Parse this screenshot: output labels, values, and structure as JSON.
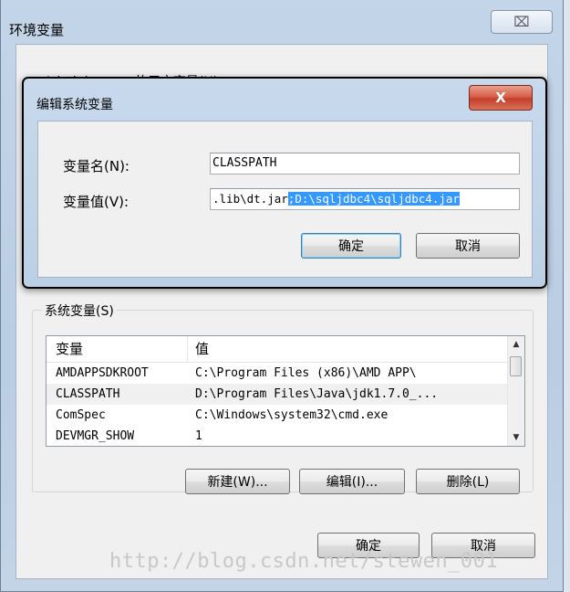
{
  "outer_dialog": {
    "title": "环境变量",
    "close_glyph": "⌧",
    "user_vars_label": "Administrator 的用户变量(U)",
    "system_vars_label": "系统变量(S)",
    "table": {
      "col_name": "变量",
      "col_value": "值",
      "rows": [
        {
          "name": "AMDAPPSDKROOT",
          "value": "C:\\Program Files (x86)\\AMD APP\\"
        },
        {
          "name": "CLASSPATH",
          "value": "D:\\Program Files\\Java\\jdk1.7.0_..."
        },
        {
          "name": "ComSpec",
          "value": "C:\\Windows\\system32\\cmd.exe"
        },
        {
          "name": "DEVMGR_SHOW",
          "value": "1"
        }
      ],
      "selected_row": 1
    },
    "buttons": {
      "new": "新建(W)...",
      "edit": "编辑(I)...",
      "delete": "删除(L)",
      "ok": "确定",
      "cancel": "取消"
    }
  },
  "inner_dialog": {
    "title": "编辑系统变量",
    "close_glyph": "X",
    "name_label": "变量名(N):",
    "value_label": "变量值(V):",
    "name_value": "CLASSPATH",
    "value_unselected": ".lib\\dt.jar",
    "value_selected": ";D:\\sqljdbc4\\sqljdbc4.jar",
    "ok": "确定",
    "cancel": "取消"
  },
  "watermark": "http://blog.csdn.net/stewen_001"
}
